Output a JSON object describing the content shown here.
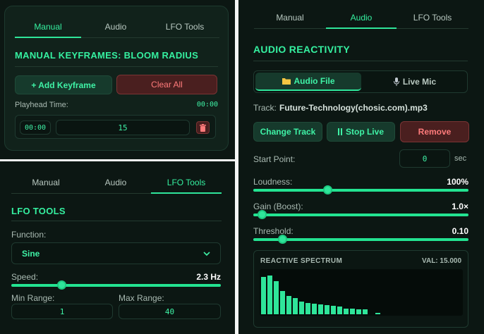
{
  "manual": {
    "tabs": [
      {
        "label": "Manual",
        "active": true
      },
      {
        "label": "Audio",
        "active": false
      },
      {
        "label": "LFO Tools",
        "active": false
      }
    ],
    "title": "MANUAL KEYFRAMES: BLOOM RADIUS",
    "add_label": "+ Add Keyframe",
    "clear_label": "Clear All",
    "playhead_label": "Playhead Time:",
    "playhead_value": "00:00",
    "keyframe_time": "00:00",
    "keyframe_value": "15",
    "delete_icon": "trash-icon"
  },
  "lfo": {
    "tabs": [
      {
        "label": "Manual",
        "active": false
      },
      {
        "label": "Audio",
        "active": false
      },
      {
        "label": "LFO Tools",
        "active": true
      }
    ],
    "title": "LFO TOOLS",
    "function_label": "Function:",
    "function_value": "Sine",
    "speed_label": "Speed:",
    "speed_value": "2.3 Hz",
    "speed_fraction": 0.23,
    "min_label": "Min Range:",
    "min_value": "1",
    "max_label": "Max Range:",
    "max_value": "40"
  },
  "audio": {
    "tabs": [
      {
        "label": "Manual",
        "active": false
      },
      {
        "label": "Audio",
        "active": true
      },
      {
        "label": "LFO Tools",
        "active": false
      }
    ],
    "title": "AUDIO REACTIVITY",
    "source_file_label": "Audio File",
    "source_mic_label": "Live Mic",
    "track_label": "Track:",
    "track_name": "Future-Technology(chosic.com).mp3",
    "change_label": "Change Track",
    "stop_label": "Stop Live",
    "remove_label": "Remove",
    "start_label": "Start Point:",
    "start_value": "0",
    "start_unit": "sec",
    "loudness_label": "Loudness:",
    "loudness_value": "100%",
    "loudness_fraction": 0.34,
    "gain_label": "Gain (Boost):",
    "gain_value": "1.0×",
    "gain_fraction": 0.02,
    "threshold_label": "Threshold:",
    "threshold_value": "0.10",
    "threshold_fraction": 0.12,
    "spectrum_title": "REACTIVE SPECTRUM",
    "spectrum_val": "VAL: 15.000",
    "spectrum_levels": [
      0.88,
      0.92,
      0.78,
      0.55,
      0.43,
      0.38,
      0.3,
      0.27,
      0.25,
      0.23,
      0.22,
      0.2,
      0.18,
      0.14,
      0.13,
      0.12,
      0.12,
      0,
      0.04
    ],
    "colors": {
      "accent": "#2fe59a",
      "danger": "#ff7b7b",
      "bg": "#0c1713"
    }
  }
}
